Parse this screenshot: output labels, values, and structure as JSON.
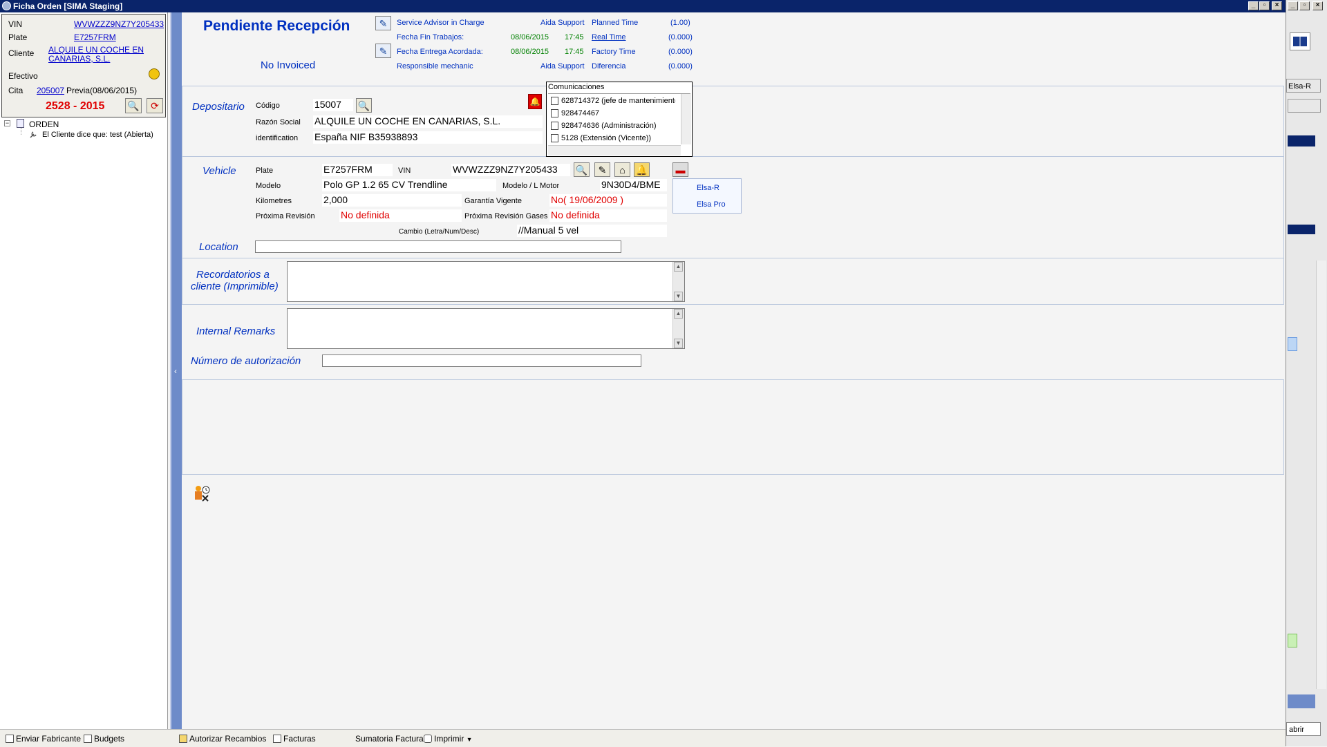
{
  "window": {
    "title": "Ficha Orden [SIMA Staging]"
  },
  "left": {
    "vin_label": "VIN",
    "vin": "WVWZZZ9NZ7Y205433",
    "plate_label": "Plate",
    "plate": "E7257FRM",
    "cliente_label": "Cliente",
    "cliente_line1": "ALQUILE UN COCHE EN",
    "cliente_line2": "CANARIAS, S.L.",
    "efectivo_label": "Efectivo",
    "cita_label": "Cita",
    "cita_num": "205007",
    "cita_prev": "Previa(08/06/2015)",
    "order_number": "2528 - 2015",
    "tree": {
      "root": "ORDEN",
      "child": "El Cliente dice que: test (Abierta)"
    }
  },
  "header": {
    "status": "Pendiente Recepción",
    "invoice_status": "No Invoiced",
    "rows": [
      {
        "label": "Service Advisor in Charge",
        "date": "",
        "time": "",
        "value": "Aida Support",
        "label2": "Planned Time",
        "value2": "(1.00)",
        "link2": false
      },
      {
        "label": "Fecha Fin Trabajos:",
        "date": "08/06/2015",
        "time": "17:45",
        "value": "",
        "label2": "Real Time",
        "value2": "(0.000)",
        "link2": true
      },
      {
        "label": "Fecha Entrega Acordada:",
        "date": "08/06/2015",
        "time": "17:45",
        "value": "",
        "label2": "Factory Time",
        "value2": "(0.000)",
        "link2": false
      },
      {
        "label": "Responsible mechanic",
        "date": "",
        "time": "",
        "value": "Aida Support",
        "label2": "Diferencia",
        "value2": "(0.000)",
        "link2": false
      }
    ]
  },
  "depositario": {
    "title": "Depositario",
    "codigo_label": "Código",
    "codigo": "15007",
    "razon_label": "Razón Social",
    "razon": "ALQUILE UN COCHE EN CANARIAS, S.L.",
    "ident_label": "identification",
    "ident": "España NIF B35938893"
  },
  "comunicaciones": {
    "title": "Comunicaciones",
    "items": [
      "628714372 (jefe de mantenimiento)",
      "928474467",
      "928474636 (Administración)",
      "5128 (Extensión (Vicente))"
    ]
  },
  "vehicle": {
    "title": "Vehicle",
    "plate_label": "Plate",
    "plate": "E7257FRM",
    "vin_label": "VIN",
    "vin": "WVWZZZ9NZ7Y205433",
    "modelo_label": "Modelo",
    "modelo": "Polo GP 1.2 65 CV Trendline",
    "motor_label": "Modelo / L Motor",
    "motor": "9N30D4/BME",
    "km_label": "Kilometres",
    "km": "2,000",
    "garantia_label": "Garantía Vigente",
    "garantia": "No( 19/06/2009 )",
    "revision_label": "Próxima Revisión",
    "revision": "No definida",
    "gases_label": "Próxima Revisión Gases",
    "gases": "No definida",
    "cambio_label": "Cambio (Letra/Num/Desc)",
    "cambio": "//Manual 5 vel",
    "elsa": [
      "Elsa-R",
      "Elsa Pro"
    ]
  },
  "location": {
    "label": "Location",
    "value": ""
  },
  "recordatorios": {
    "label_line1": "Recordatorios a",
    "label_line2": "cliente (Imprimible)",
    "value": ""
  },
  "internal": {
    "label": "Internal Remarks",
    "value": ""
  },
  "autorizacion": {
    "label": "Número de autorización",
    "value": ""
  },
  "bottombar": {
    "items": [
      "Enviar Fabricante",
      "Budgets",
      "Autorizar Recambios",
      "Facturas",
      "Sumatoria Factura",
      "Imprimir"
    ]
  },
  "rightstrip": {
    "elsa": "Elsa-R",
    "abrir": "abrir"
  }
}
